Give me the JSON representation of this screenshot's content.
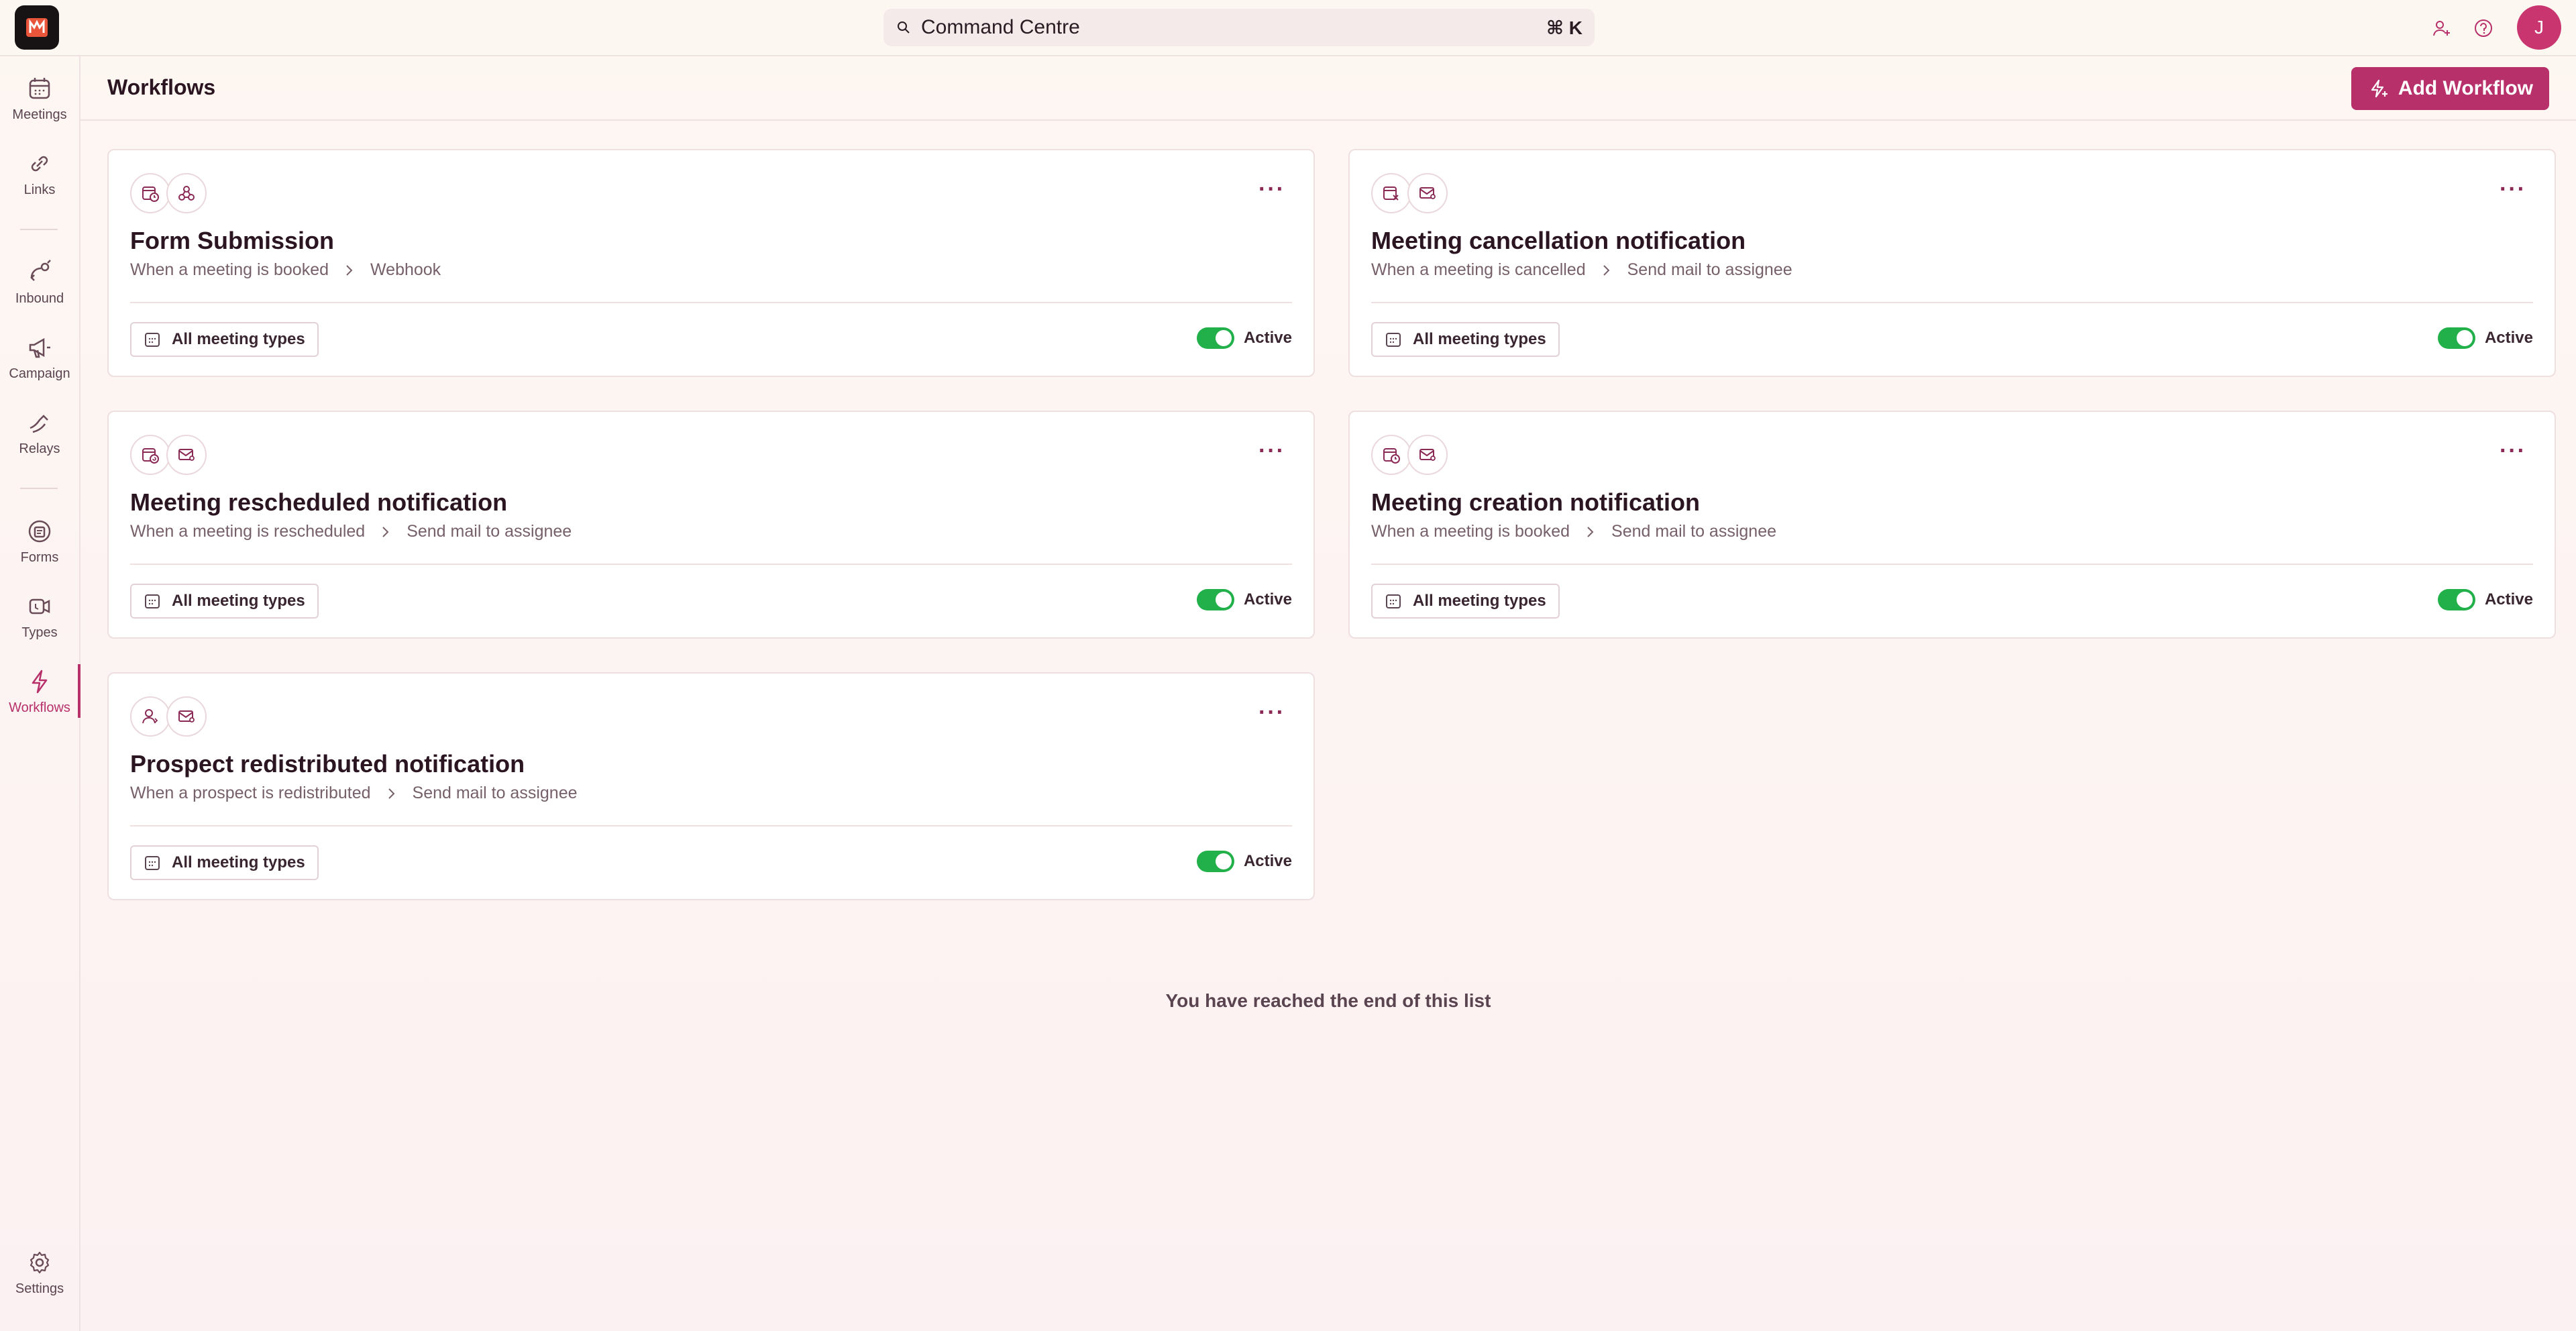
{
  "topbar": {
    "search_label": "Command Centre",
    "shortcut": "⌘ K",
    "avatar_initial": "J"
  },
  "sidebar": {
    "items": [
      {
        "label": "Meetings",
        "icon": "calendar-icon"
      },
      {
        "label": "Links",
        "icon": "link-icon"
      },
      {
        "label": "Inbound",
        "icon": "inbound-icon"
      },
      {
        "label": "Campaign",
        "icon": "megaphone-icon"
      },
      {
        "label": "Relays",
        "icon": "relay-icon"
      },
      {
        "label": "Forms",
        "icon": "forms-icon"
      },
      {
        "label": "Types",
        "icon": "types-icon"
      },
      {
        "label": "Workflows",
        "icon": "lightning-icon"
      },
      {
        "label": "Settings",
        "icon": "gear-icon"
      }
    ],
    "active": "Workflows"
  },
  "header": {
    "title": "Workflows",
    "add_button": "Add Workflow"
  },
  "workflows": [
    {
      "title": "Form Submission",
      "trigger": "When a meeting is booked",
      "action": "Webhook",
      "tag": "All meeting types",
      "status": "Active"
    },
    {
      "title": "Meeting cancellation notification",
      "trigger": "When a meeting is cancelled",
      "action": "Send mail to assignee",
      "tag": "All meeting types",
      "status": "Active"
    },
    {
      "title": "Meeting rescheduled notification",
      "trigger": "When a meeting is rescheduled",
      "action": "Send mail to assignee",
      "tag": "All meeting types",
      "status": "Active"
    },
    {
      "title": "Meeting creation notification",
      "trigger": "When a meeting is booked",
      "action": "Send mail to assignee",
      "tag": "All meeting types",
      "status": "Active"
    },
    {
      "title": "Prospect redistributed notification",
      "trigger": "When a prospect is redistributed",
      "action": "Send mail to assignee",
      "tag": "All meeting types",
      "status": "Active"
    }
  ],
  "end_of_list": "You have reached the end of this list",
  "colors": {
    "accent": "#b8306a",
    "active_toggle": "#22b04a",
    "icon_stroke": "#8a2a55"
  }
}
